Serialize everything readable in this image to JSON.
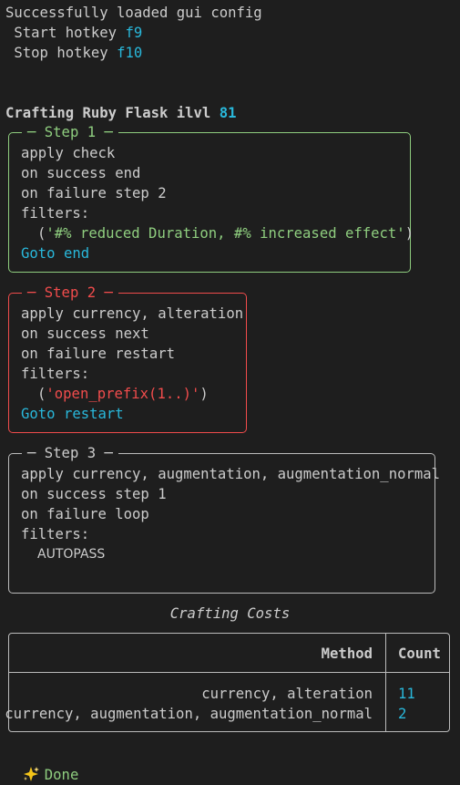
{
  "header": {
    "loaded": "Successfully loaded gui config",
    "start_hotkey_label": " Start hotkey ",
    "start_hotkey_value": "f9",
    "stop_hotkey_label": " Stop hotkey ",
    "stop_hotkey_value": "f10"
  },
  "crafting": {
    "prefix": "Crafting Ruby Flask ilvl ",
    "ilvl": "81"
  },
  "steps": [
    {
      "title": "Step 1",
      "apply": "apply check",
      "on_success": "on success end",
      "on_failure": "on failure step 2",
      "filters_label": "filters:",
      "filter_open": "(",
      "filter_value": "'#% reduced Duration, #% increased effect'",
      "filter_close": ")",
      "goto": "Goto end",
      "border_color": "#8fce7f"
    },
    {
      "title": "Step 2",
      "apply": "apply currency, alteration",
      "on_success": "on success next",
      "on_failure": "on failure restart",
      "filters_label": "filters:",
      "filter_open": "(",
      "filter_value": "'open_prefix(1..)'",
      "filter_close": ")",
      "goto": "Goto restart",
      "border_color": "#f14c4c"
    },
    {
      "title": "Step 3",
      "apply": "apply currency, augmentation, augmentation_normal",
      "on_success": "on success step 1",
      "on_failure": "on failure loop",
      "filters_label": "filters:",
      "filter_value": "AUTOPASS",
      "border_color": "#bbbbbb"
    }
  ],
  "costs": {
    "title": "Crafting Costs",
    "headers": [
      "Method",
      "Count"
    ],
    "rows": [
      {
        "method": "currency, alteration",
        "count": "11"
      },
      {
        "method": "currency, augmentation, augmentation_normal",
        "count": "2"
      }
    ]
  },
  "footer": {
    "icon": "sparkles-icon",
    "status": "Done"
  }
}
